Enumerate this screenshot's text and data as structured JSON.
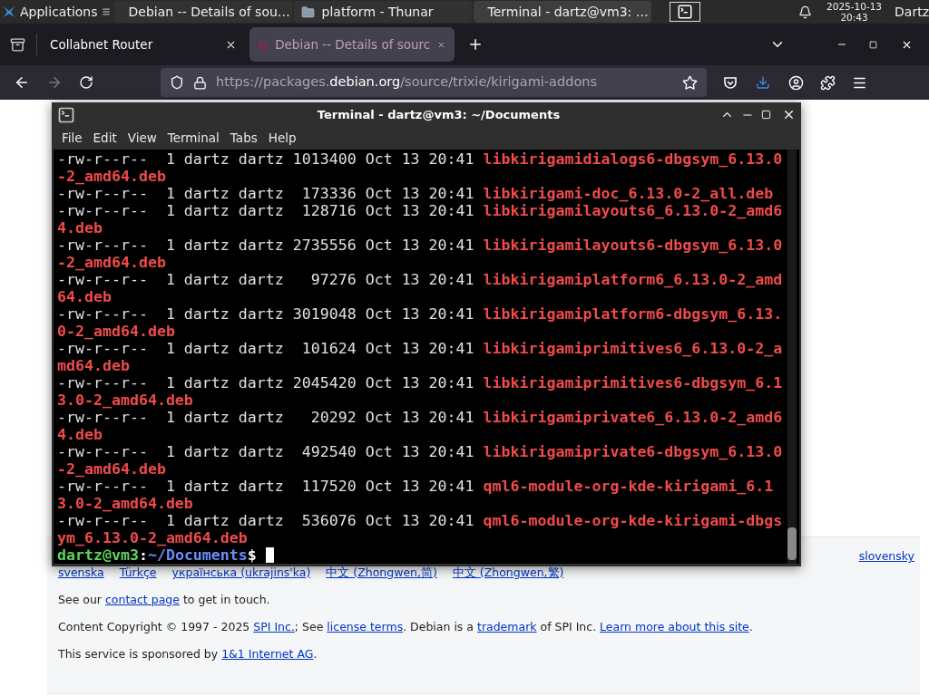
{
  "top_panel": {
    "applications_label": "Applications",
    "tasks": [
      {
        "kind": "browser",
        "label": "Debian -- Details of sou…",
        "selected": false
      },
      {
        "kind": "folder",
        "label": "platform - Thunar",
        "selected": false
      },
      {
        "kind": "terminal",
        "label": "Terminal - dartz@vm3: …",
        "selected": true
      }
    ],
    "date": "2025-10-13",
    "time": "20:43",
    "user": "Dartz"
  },
  "browser": {
    "tabs": [
      {
        "label": "Collabnet Router",
        "selected": false
      },
      {
        "label": "Debian -- Details of sourc",
        "selected": true
      }
    ],
    "forward_disabled": true,
    "url": {
      "prefix": "https://packages.",
      "domain": "debian.org",
      "path": "/source/trixie/kirigami-addons"
    }
  },
  "terminal": {
    "title": "Terminal - dartz@vm3: ~/Documents",
    "menu": [
      "File",
      "Edit",
      "View",
      "Terminal",
      "Tabs",
      "Help"
    ],
    "rows": [
      {
        "info": "-rw-r--r--  1 dartz dartz 1013400 Oct 13 20:41",
        "name": "libkirigamidialogs6-dbgsym_6.13.0-2_amd64.deb"
      },
      {
        "info": "-rw-r--r--  1 dartz dartz  173336 Oct 13 20:41",
        "name": "libkirigami-doc_6.13.0-2_all.deb"
      },
      {
        "info": "-rw-r--r--  1 dartz dartz  128716 Oct 13 20:41",
        "name": "libkirigamilayouts6_6.13.0-2_amd64.deb"
      },
      {
        "info": "-rw-r--r--  1 dartz dartz 2735556 Oct 13 20:41",
        "name": "libkirigamilayouts6-dbgsym_6.13.0-2_amd64.deb"
      },
      {
        "info": "-rw-r--r--  1 dartz dartz   97276 Oct 13 20:41",
        "name": "libkirigamiplatform6_6.13.0-2_amd64.deb"
      },
      {
        "info": "-rw-r--r--  1 dartz dartz 3019048 Oct 13 20:41",
        "name": "libkirigamiplatform6-dbgsym_6.13.0-2_amd64.deb"
      },
      {
        "info": "-rw-r--r--  1 dartz dartz  101624 Oct 13 20:41",
        "name": "libkirigamiprimitives6_6.13.0-2_amd64.deb"
      },
      {
        "info": "-rw-r--r--  1 dartz dartz 2045420 Oct 13 20:41",
        "name": "libkirigamiprimitives6-dbgsym_6.13.0-2_amd64.deb"
      },
      {
        "info": "-rw-r--r--  1 dartz dartz   20292 Oct 13 20:41",
        "name": "libkirigamiprivate6_6.13.0-2_amd64.deb"
      },
      {
        "info": "-rw-r--r--  1 dartz dartz  492540 Oct 13 20:41",
        "name": "libkirigamiprivate6-dbgsym_6.13.0-2_amd64.deb"
      },
      {
        "info": "-rw-r--r--  1 dartz dartz  117520 Oct 13 20:41",
        "name": "qml6-module-org-kde-kirigami_6.13.0-2_amd64.deb"
      },
      {
        "info": "-rw-r--r--  1 dartz dartz  536076 Oct 13 20:41",
        "name": "qml6-module-org-kde-kirigami-dbgsym_6.13.0-2_amd64.deb"
      }
    ],
    "prompt": {
      "user_host": "dartz@vm3",
      "separator": ":",
      "path": "~/Documents",
      "symbol": "$"
    }
  },
  "footer": {
    "languages_row_1": [
      "slovensky"
    ],
    "languages": [
      "svenska",
      "Türkçe",
      "українська (ukrajins'ka)",
      "中文 (Zhongwen,简)",
      "中文 (Zhongwen,繁)"
    ],
    "paragraphs": [
      [
        {
          "text": "See our "
        },
        {
          "text": "contact page",
          "link": true
        },
        {
          "text": " to get in touch."
        }
      ],
      [
        {
          "text": "Content Copyright © 1997 - 2025 "
        },
        {
          "text": "SPI Inc.",
          "link": true
        },
        {
          "text": "; See "
        },
        {
          "text": "license terms",
          "link": true
        },
        {
          "text": ". Debian is a "
        },
        {
          "text": "trademark",
          "link": true
        },
        {
          "text": " of SPI Inc. "
        },
        {
          "text": "Learn more about this site",
          "link": true
        },
        {
          "text": "."
        }
      ],
      [
        {
          "text": "This service is sponsored by "
        },
        {
          "text": "1&1 Internet AG",
          "link": true
        },
        {
          "text": "."
        }
      ]
    ]
  }
}
